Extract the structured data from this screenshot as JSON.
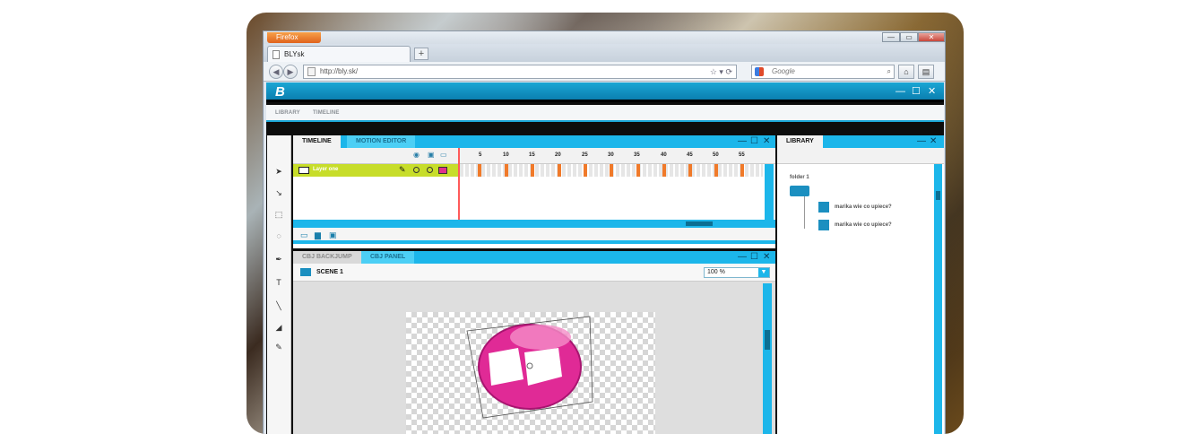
{
  "browser": {
    "menu_button": "Firefox",
    "tab_title": "BLYsk",
    "new_tab": "+",
    "url": "http://bly.sk/",
    "search_placeholder": "Google",
    "win_minimize": "—",
    "win_restore": "▭",
    "win_close": "✕"
  },
  "app": {
    "logo": "B",
    "header_controls": [
      "—",
      "☐",
      "✕"
    ],
    "menu": [
      "LIBRARY",
      "TIMELINE"
    ],
    "timeline_panel": {
      "tabs": [
        "TIMELINE",
        "MOTION EDITOR"
      ],
      "frame_numbers": [
        "5",
        "10",
        "15",
        "20",
        "25",
        "30",
        "35",
        "40",
        "45",
        "50",
        "55"
      ],
      "layer_name": "Layer one"
    },
    "stage_panel": {
      "tabs": [
        "CBJ BACKJUMP",
        "CBJ PANEL"
      ],
      "scene": "SCENE 1",
      "zoom": "100 %"
    },
    "library_panel": {
      "title": "LIBRARY",
      "folder": "folder 1",
      "items": [
        "marika wie co upiece?",
        "marika wie co upiece?"
      ]
    },
    "panel_controls": [
      "—",
      "☐",
      "✕"
    ],
    "accent_color": "#1cb6ea",
    "layer_color": "#c7dd2a",
    "keyframe_color": "#f07a2a"
  }
}
